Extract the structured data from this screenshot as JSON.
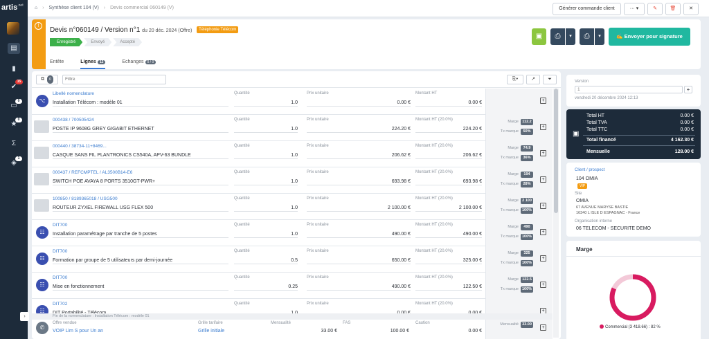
{
  "brand": {
    "name": "artis",
    "suffix": ".net"
  },
  "sidebar_badges": {
    "check": "15",
    "chat": "0",
    "star": "0",
    "box": "1"
  },
  "breadcrumb": [
    "Synthèse client 104 (V)",
    "Devis commercial 060149 (V)"
  ],
  "topbar": {
    "generate_order": "Générer commande client",
    "more": "···"
  },
  "quote": {
    "title": "Devis n°060149 / Version n°1",
    "subtitle": "du 20 déc. 2024 (Offre)",
    "tag": "Téléphonie Télécom",
    "steps": [
      "Enregistré",
      "Envoyé",
      "Accepté"
    ],
    "send_label": "Envoyer pour signature"
  },
  "tabs": [
    {
      "label": "Entête"
    },
    {
      "label": "Lignes",
      "count": "12"
    },
    {
      "label": "Echanges",
      "count": "0 / 0"
    }
  ],
  "list": {
    "filter_placeholder": "Filtre",
    "count_badge": "0"
  },
  "columns": {
    "lib_nomenclature": "Libellé nomenclature",
    "qty": "Quantité",
    "unit_price": "Prix unitaire",
    "amount_ht": "Montant HT",
    "amount_ht_disc": "Montant HT (20.0%)",
    "marge": "Marge",
    "tx_marque": "Tx marque"
  },
  "rows": [
    {
      "code": "Libellé nomenclature",
      "label": "Installation Télécom : modèle 01",
      "qty": "1.0",
      "price": "0.00 €",
      "amount": "0.00 €",
      "kind": "nomen"
    },
    {
      "code": "000438 / 700505424",
      "label": "POSTE IP 9608G GREY GIGABIT ETHERNET",
      "qty": "1.0",
      "price": "224.20 €",
      "amount": "224.20 €",
      "marge": "112.2",
      "tx": "50%",
      "kind": "item"
    },
    {
      "code": "000440 / 38734-11+8469...",
      "label": "CASQUE SANS FIL PLANTRONICS CS540A, APV-63 BUNDLE",
      "qty": "1.0",
      "price": "206.62 €",
      "amount": "206.62 €",
      "marge": "74.9",
      "tx": "36%",
      "kind": "item"
    },
    {
      "code": "000437 / REFCMPTEL / AL3500B14-E6",
      "label": "SWITCH POE AVAYA 8 PORTS 3510GT-PWR+",
      "qty": "1.0",
      "price": "693.98 €",
      "amount": "693.98 €",
      "marge": "194",
      "tx": "28%",
      "kind": "item"
    },
    {
      "code": "100850 / 8189365018 / USG500",
      "label": "ROUTEUR ZYXEL FIREWALL USG FLEX 500",
      "qty": "1.0",
      "price": "2 100.00 €",
      "amount": "2 100.00 €",
      "marge": "2 100",
      "tx": "100%",
      "kind": "item"
    },
    {
      "code": "DIT700",
      "label": "Installation paramétrage par tranche de 5 postes",
      "qty": "1.0",
      "price": "490.00 €",
      "amount": "490.00 €",
      "marge": "490",
      "tx": "100%",
      "kind": "service"
    },
    {
      "code": "DIT700",
      "label": "Formation par groupe de 5 utilisateurs par demi-journée",
      "qty": "0.5",
      "price": "650.00 €",
      "amount": "325.00 €",
      "marge": "325",
      "tx": "100%",
      "kind": "service"
    },
    {
      "code": "DIT700",
      "label": "Mise en fonctionnement",
      "qty": "0.25",
      "price": "490.00 €",
      "amount": "122.50 €",
      "marge": "122.5",
      "tx": "100%",
      "kind": "service"
    },
    {
      "code": "DIT702",
      "label": "DIT Portabilité - Télécom",
      "qty": "1.0",
      "price": "0.00 €",
      "amount": "0.00 €",
      "kind": "service"
    }
  ],
  "end_nomenclature": "Fin de la nomenclature : Installation Télécom : modèle 01",
  "last_row": {
    "h_offer": "Offre vendue",
    "offer": "VOIP Lim S pour Un an",
    "h_grid": "Grille tarifaire",
    "grid": "Grille initiale",
    "h_monthly": "Mensualité",
    "monthly": "33.00 €",
    "h_fas": "FAS",
    "fas": "100.00 €",
    "h_caution": "Caution",
    "caution": "0.00 €",
    "m_label": "Mensualité",
    "m_value": "33.00"
  },
  "version": {
    "label": "Version",
    "value": "1",
    "date": "vendredi 20 décembre 2024 12:13"
  },
  "totals": [
    {
      "label": "Total HT",
      "value": "0.00 €"
    },
    {
      "label": "Total TVA",
      "value": "0.00 €"
    },
    {
      "label": "Total TTC",
      "value": "0.00 €"
    },
    {
      "label": "Total financé",
      "value": "4 162.30 €"
    },
    {
      "label": "Mensuelle",
      "value": "128.00 €"
    }
  ],
  "client": {
    "label": "Client / prospect",
    "name": "104 OMIA",
    "vip": "VIP",
    "site_label": "Site",
    "site_name": "OMIA",
    "addr1": "67 AVENUE MARYSE BASTIE",
    "addr2": "16340 L ISLE D ESPAGNAC - France",
    "org_label": "Organisation interne",
    "org": "06 TELECOM - SECURITE DEMO"
  },
  "marge_panel": {
    "title": "Marge",
    "legend": "Commercial (3 418.66) : 82 %",
    "fraction": 0.82
  },
  "colors": {
    "accent": "#20b8a0",
    "orange": "#f39c12",
    "donut": "#d81b60",
    "sidebar": "#1d2b3a"
  }
}
